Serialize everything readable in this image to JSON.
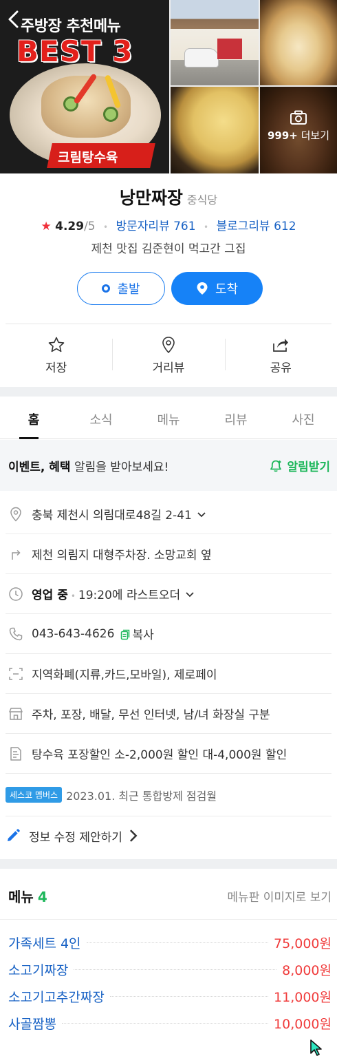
{
  "photos": {
    "main_line1": "주방장 추천메뉴",
    "main_line2": "BEST 3",
    "main_ribbon": "크림탕수육",
    "more_count": "999+",
    "more_label": "더보기"
  },
  "place": {
    "name": "낭만짜장",
    "category": "중식당",
    "rating": "4.29",
    "rating_max": "/5",
    "visitor_reviews": "방문자리뷰 761",
    "blog_reviews": "블로그리뷰 612",
    "description": "제천 맛집 김준현이 먹고간 그집"
  },
  "buttons": {
    "start": "출발",
    "arrive": "도착"
  },
  "actions": [
    {
      "label": "저장",
      "icon": "star-icon"
    },
    {
      "label": "거리뷰",
      "icon": "location-pin-icon"
    },
    {
      "label": "공유",
      "icon": "share-icon"
    }
  ],
  "tabs": [
    "홈",
    "소식",
    "메뉴",
    "리뷰",
    "사진"
  ],
  "event": {
    "bold": "이벤트, 혜택",
    "rest": " 알림을 받아보세요!",
    "action": "알림받기"
  },
  "info": {
    "address": "충북 제천시 의림대로48길 2-41",
    "directions": "제천 의림지 대형주차장. 소망교회 옆",
    "status": "영업 중",
    "hours": "19:20에 라스트오더",
    "phone": "043-643-4626",
    "copy": "복사",
    "payment": "지역화폐(지류,카드,모바일), 제로페이",
    "amenities": "주차, 포장, 배달, 무선 인터넷, 남/녀 화장실 구분",
    "discount": "탕수육 포장할인 소-2,000원 할인 대-4,000원 할인",
    "badge": "세스코 멤버스",
    "inspection": "2023.01. 최근 통합방제 점검월",
    "suggest": "정보 수정 제안하기"
  },
  "menu": {
    "title": "메뉴",
    "count": "4",
    "link": "메뉴판 이미지로 보기",
    "items": [
      {
        "name": "가족세트 4인",
        "price": "75,000원"
      },
      {
        "name": "소고기짜장",
        "price": "8,000원"
      },
      {
        "name": "소고기고추간짜장",
        "price": "11,000원"
      },
      {
        "name": "사골짬뽕",
        "price": "10,000원"
      }
    ]
  },
  "colors": {
    "primary_blue": "#1682f7",
    "link_blue": "#1a63c5",
    "accent_green": "#1eb75b",
    "price_red": "#f03c3c",
    "star_red": "#f0303a"
  }
}
